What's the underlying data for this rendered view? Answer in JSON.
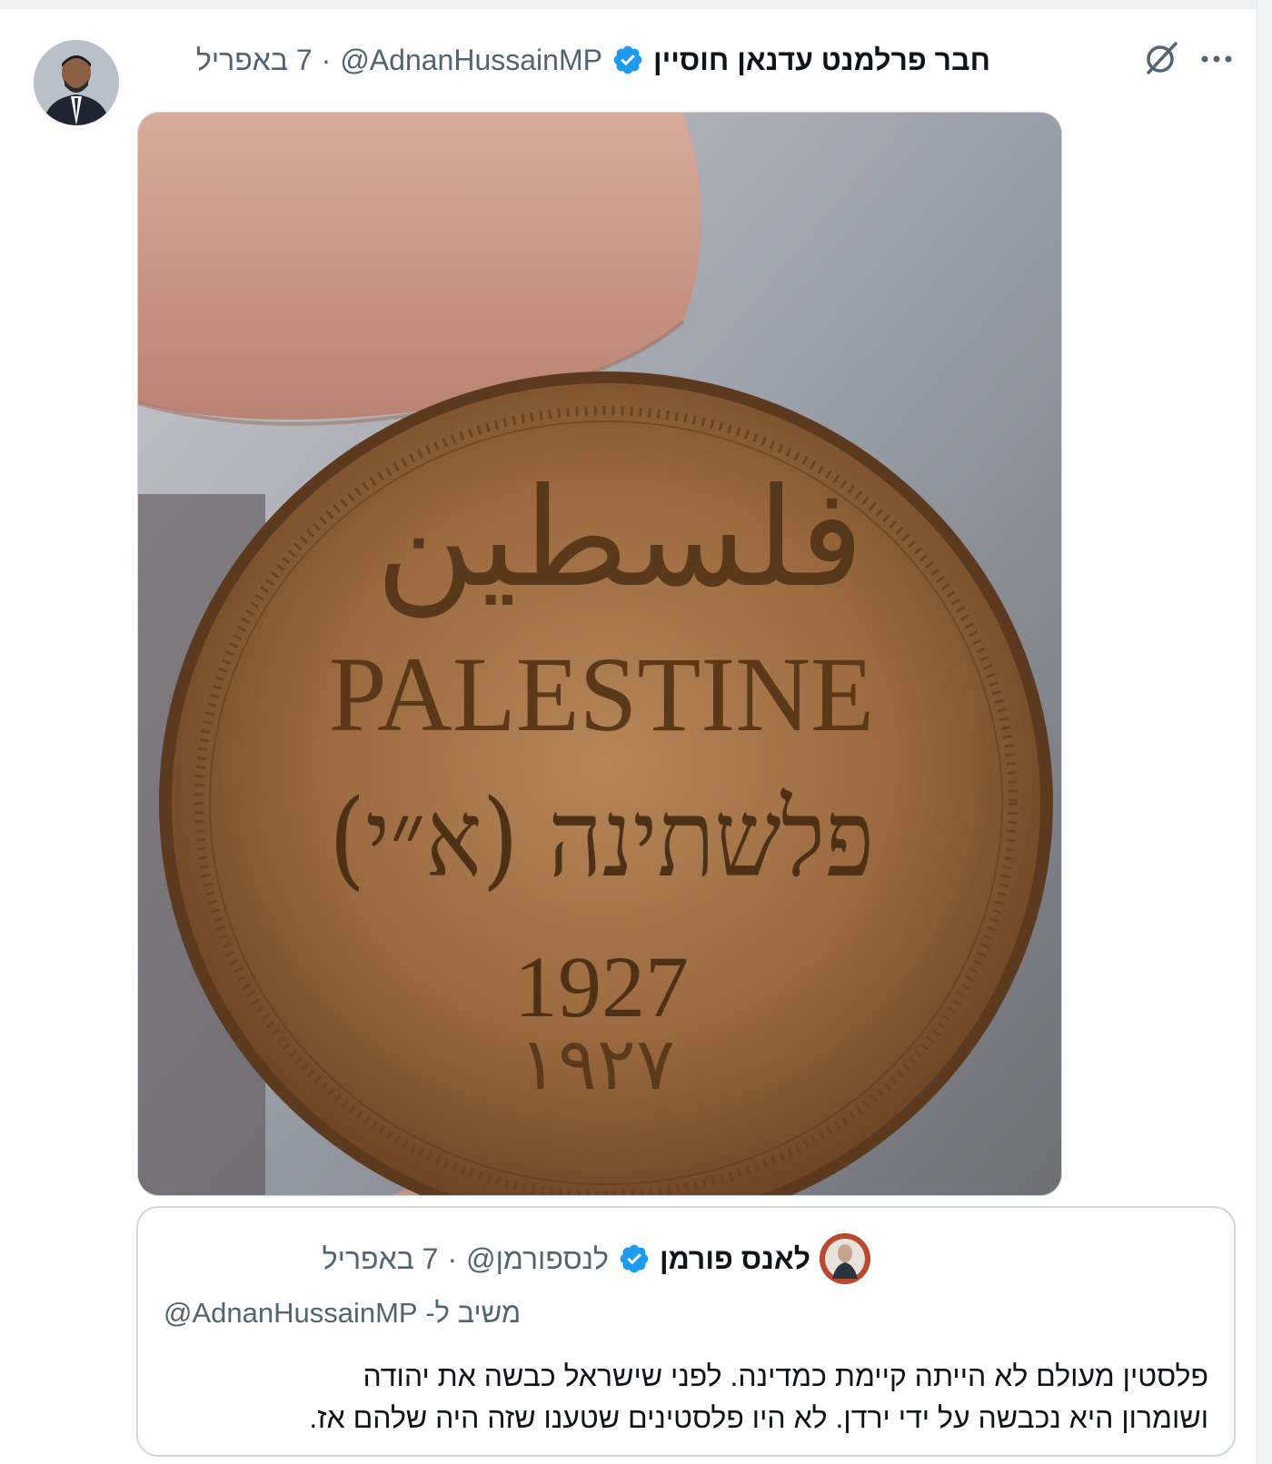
{
  "tweet": {
    "display_name": "חבר פרלמנט עדנאן חוסיין",
    "handle": "@AdnanHussainMP",
    "dot": "·",
    "date": "7 באפריל"
  },
  "media": {
    "coin_text_arabic": "فلسطين",
    "coin_text_english": "PALESTINE",
    "coin_text_hebrew": "פלשתינה (א״י)",
    "coin_year": "1927",
    "coin_year_arabic": "١٩٢٧"
  },
  "quote": {
    "display_name": "לאנס פורמן",
    "handle": "@לנספורמן",
    "dot": "·",
    "date": "7 באפריל",
    "reply_prefix": "משיב ל-",
    "reply_handle": "@AdnanHussainMP",
    "text_line1": "פלסטין מעולם לא הייתה קיימת כמדינה. לפני שישראל כבשה את יהודה",
    "text_line2": "ושומרון היא נכבשה על ידי ירדן. לא היו פלסטינים שטענו שזה היה שלהם אז."
  },
  "colors": {
    "verified_blue": "#1d9bf0",
    "secondary_text": "#536471",
    "coin_bronze": "#9a6a3e"
  },
  "icons": {
    "verified": "verified-badge-icon",
    "grok": "grok-icon",
    "more": "more-options-icon"
  }
}
